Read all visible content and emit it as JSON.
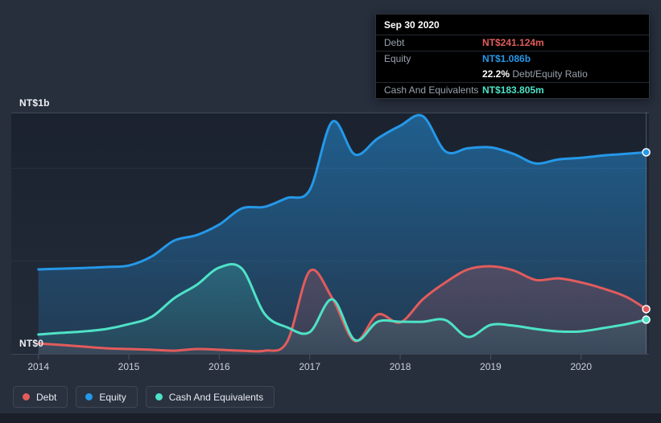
{
  "axis": {
    "y_top_label": "NT$1b",
    "y_bottom_label": "NT$0",
    "x_labels": [
      "2014",
      "2015",
      "2016",
      "2017",
      "2018",
      "2019",
      "2020"
    ]
  },
  "tooltip": {
    "date": "Sep 30 2020",
    "debt_label": "Debt",
    "debt_value": "NT$241.124m",
    "equity_label": "Equity",
    "equity_value": "NT$1.086b",
    "ratio_value": "22.2%",
    "ratio_label": "Debt/Equity Ratio",
    "cash_label": "Cash And Equivalents",
    "cash_value": "NT$183.805m"
  },
  "legend": [
    {
      "label": "Debt",
      "color": "#e25c5c"
    },
    {
      "label": "Equity",
      "color": "#2598e8"
    },
    {
      "label": "Cash And Equivalents",
      "color": "#4ee2c6"
    }
  ],
  "colors": {
    "page_bg": "#272e3c",
    "plot_bg_top": "#1b222f",
    "plot_bg_bottom": "#232b39",
    "grid_bright": "#3f4858",
    "grid_subtle": "#2b3342",
    "tick": "#4a5364",
    "crosshair": "rgba(220,228,240,0.28)",
    "tooltip_bg": "#000000",
    "debt": "#e25c5c",
    "equity": "#2598e8",
    "cash": "#4ee2c6"
  },
  "chart_data": {
    "type": "area",
    "title": "Debt to Equity History and Analysis",
    "unit": "NT$ millions",
    "xlim": [
      2013.7,
      2020.75
    ],
    "ylim": [
      0,
      1300
    ],
    "x_ticks": [
      2014,
      2015,
      2016,
      2017,
      2018,
      2019,
      2020
    ],
    "gridline_values": [
      1000,
      500
    ],
    "y_labeled_values": {
      "NT$1b": 1000,
      "NT$0": 0
    },
    "hover_date": "Sep 30 2020",
    "x": [
      2014.0,
      2014.25,
      2014.5,
      2014.75,
      2015.0,
      2015.25,
      2015.5,
      2015.75,
      2016.0,
      2016.25,
      2016.5,
      2016.75,
      2017.0,
      2017.25,
      2017.5,
      2017.75,
      2018.0,
      2018.25,
      2018.5,
      2018.75,
      2019.0,
      2019.25,
      2019.5,
      2019.75,
      2020.0,
      2020.25,
      2020.5,
      2020.72
    ],
    "series": [
      {
        "name": "Equity",
        "color": "#2598e8",
        "values": [
          455,
          459,
          463,
          468,
          476,
          524,
          610,
          640,
          697,
          784,
          792,
          840,
          883,
          1251,
          1074,
          1160,
          1229,
          1281,
          1091,
          1108,
          1113,
          1078,
          1026,
          1048,
          1056,
          1069,
          1078,
          1086
        ]
      },
      {
        "name": "Cash And Equivalents",
        "color": "#4ee2c6",
        "values": [
          104,
          113,
          121,
          134,
          160,
          199,
          299,
          372,
          465,
          459,
          216,
          143,
          117,
          294,
          74,
          173,
          173,
          173,
          182,
          91,
          156,
          152,
          134,
          121,
          121,
          139,
          160,
          184
        ]
      },
      {
        "name": "Debt",
        "color": "#e25c5c",
        "values": [
          56,
          48,
          39,
          30,
          26,
          22,
          17,
          26,
          22,
          17,
          17,
          65,
          446,
          299,
          69,
          212,
          169,
          294,
          385,
          455,
          472,
          450,
          398,
          407,
          385,
          351,
          307,
          241
        ]
      }
    ],
    "end_point_values": {
      "Debt": 241.124,
      "Equity": 1086,
      "Cash And Equivalents": 183.805
    },
    "legend_position": "bottom-left",
    "grid": true
  }
}
